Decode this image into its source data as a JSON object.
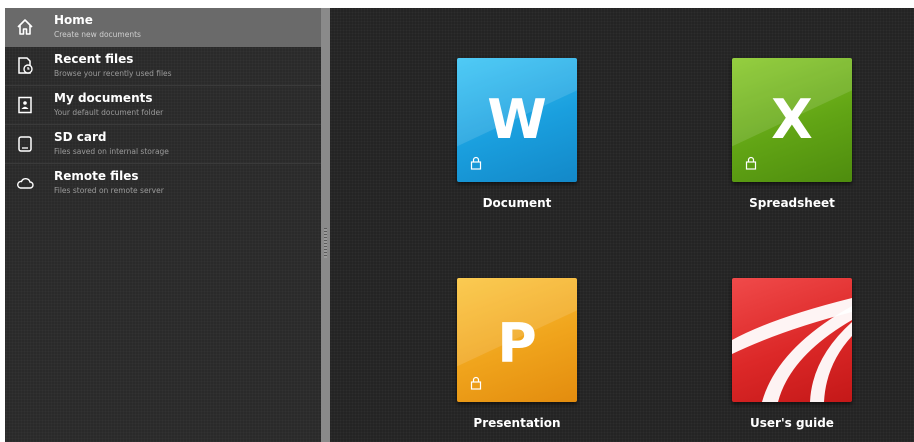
{
  "sidebar": {
    "items": [
      {
        "title": "Home",
        "subtitle": "Create new documents",
        "icon": "home-icon",
        "active": true
      },
      {
        "title": "Recent files",
        "subtitle": "Browse your recently used files",
        "icon": "recent-files-icon"
      },
      {
        "title": "My documents",
        "subtitle": "Your default document folder",
        "icon": "my-documents-icon"
      },
      {
        "title": "SD card",
        "subtitle": "Files saved on internal storage",
        "icon": "sd-card-icon"
      },
      {
        "title": "Remote files",
        "subtitle": "Files stored on remote server",
        "icon": "cloud-icon"
      }
    ]
  },
  "tiles": [
    {
      "label": "Document",
      "letter": "W",
      "color": "#1ba8e6",
      "icon": "word-icon"
    },
    {
      "label": "Spreadsheet",
      "letter": "X",
      "color": "#5fa012",
      "icon": "excel-icon"
    },
    {
      "label": "Presentation",
      "letter": "P",
      "color": "#f0a81c",
      "icon": "powerpoint-icon"
    },
    {
      "label": "User's guide",
      "letter": "",
      "color": "#e03030",
      "icon": "pdf-icon"
    }
  ],
  "colors": {
    "active_item": "#6a6a6a",
    "sidebar_bg": "#2a2a2a",
    "main_bg": "#242424"
  }
}
